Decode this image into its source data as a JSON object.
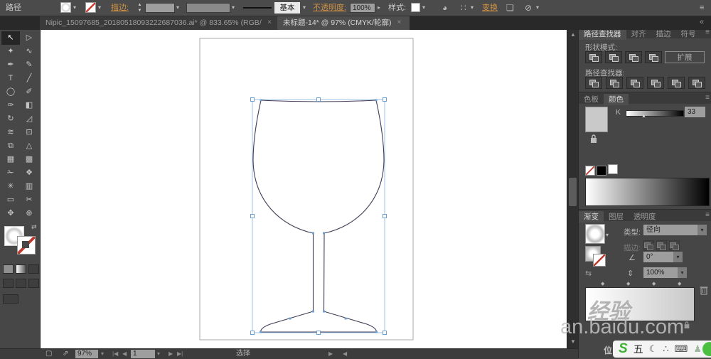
{
  "control_bar": {
    "context_label": "路径",
    "stroke_link": "描边:",
    "brush_value": "基本",
    "opacity_link": "不透明度:",
    "opacity_value": "100%",
    "style_label": "样式:",
    "transform_link": "变换"
  },
  "glyphs": {
    "caret": "▾",
    "caret_right": "▸",
    "up": "▲",
    "down": "▼",
    "left": "◀",
    "right": "▶",
    "first": "|◀",
    "last": "▶|",
    "menu": "≡",
    "collapse": "«",
    "swap": "⇄",
    "recolor": "◕",
    "align_dots": "∷",
    "frame": "❏",
    "no_slash": "⊘",
    "reverse": "⇆",
    "angle": "∠",
    "aspect": "⇕",
    "diamond": "◆",
    "doc_icon": "▢",
    "export_icon": "⇗",
    "k_thumb": "▲"
  },
  "doc_tabs": [
    {
      "title": "Nipic_15097685_20180518093222687036.ai* @ 833.65% (RGB/预览)",
      "close": "×",
      "active": false
    },
    {
      "title": "未标题-14* @ 97% (CMYK/轮廓)",
      "close": "×",
      "active": true
    }
  ],
  "toolbar": {
    "tools": [
      {
        "name": "selection-tool",
        "glyph": "↖",
        "active": true
      },
      {
        "name": "direct-selection-tool",
        "glyph": "▷",
        "active": false
      },
      {
        "name": "magic-wand-tool",
        "glyph": "✦",
        "active": false
      },
      {
        "name": "lasso-tool",
        "glyph": "∿",
        "active": false
      },
      {
        "name": "pen-tool",
        "glyph": "✒",
        "active": false
      },
      {
        "name": "curvature-tool",
        "glyph": "✎",
        "active": false
      },
      {
        "name": "type-tool",
        "glyph": "T",
        "active": false
      },
      {
        "name": "line-segment-tool",
        "glyph": "╱",
        "active": false
      },
      {
        "name": "shape-tool",
        "glyph": "◯",
        "active": false
      },
      {
        "name": "paintbrush-tool",
        "glyph": "✐",
        "active": false
      },
      {
        "name": "pencil-tool",
        "glyph": "✑",
        "active": false
      },
      {
        "name": "eraser-tool",
        "glyph": "◧",
        "active": false
      },
      {
        "name": "rotate-tool",
        "glyph": "↻",
        "active": false
      },
      {
        "name": "scale-tool",
        "glyph": "◿",
        "active": false
      },
      {
        "name": "width-tool",
        "glyph": "≋",
        "active": false
      },
      {
        "name": "free-transform-tool",
        "glyph": "⊡",
        "active": false
      },
      {
        "name": "shape-builder-tool",
        "glyph": "⧉",
        "active": false
      },
      {
        "name": "perspective-grid-tool",
        "glyph": "△",
        "active": false
      },
      {
        "name": "mesh-tool",
        "glyph": "▦",
        "active": false
      },
      {
        "name": "gradient-tool",
        "glyph": "▩",
        "active": false
      },
      {
        "name": "eyedropper-tool",
        "glyph": "✁",
        "active": false
      },
      {
        "name": "blend-tool",
        "glyph": "❖",
        "active": false
      },
      {
        "name": "symbol-sprayer-tool",
        "glyph": "✳",
        "active": false
      },
      {
        "name": "column-graph-tool",
        "glyph": "▥",
        "active": false
      },
      {
        "name": "artboard-tool",
        "glyph": "▭",
        "active": false
      },
      {
        "name": "slice-tool",
        "glyph": "✂",
        "active": false
      },
      {
        "name": "hand-tool",
        "glyph": "✥",
        "active": false
      },
      {
        "name": "zoom-tool",
        "glyph": "⊕",
        "active": false
      }
    ]
  },
  "pathfinder_panel": {
    "tabs": [
      "路径查找器",
      "对齐",
      "描边",
      "符号"
    ],
    "shape_modes_label": "形状模式:",
    "expand_button": "扩展",
    "pathfinder_label": "路径查找器:",
    "shape_mode_names": [
      "unite",
      "minus-front",
      "intersect",
      "exclude"
    ],
    "pathfinder_names": [
      "divide",
      "trim",
      "merge",
      "crop",
      "outline",
      "minus-back"
    ]
  },
  "color_panel": {
    "tabs": [
      "色板",
      "颜色"
    ],
    "active_tab": "颜色",
    "channel": "K",
    "value": "33"
  },
  "gradient_panel": {
    "tabs": [
      "渐变",
      "图层",
      "透明度"
    ],
    "active_tab": "渐变",
    "type_label": "类型:",
    "type_value": "径向",
    "stroke_label": "描边:",
    "angle_value": "0°",
    "aspect_value": "100%"
  },
  "status_bar": {
    "zoom": "97%",
    "artboard": "1",
    "status": "选择"
  },
  "watermark": {
    "logo": "经验",
    "domain": "an.baidu.com",
    "extra": "位"
  },
  "ime": {
    "logo": "S",
    "mode": "五",
    "icons": [
      {
        "name": "moon-icon",
        "glyph": "☾"
      },
      {
        "name": "sparkle-icon",
        "glyph": "∴"
      },
      {
        "name": "keyboard-icon",
        "glyph": "⌨"
      },
      {
        "name": "user-icon",
        "glyph": "♟"
      },
      {
        "name": "wrench-icon",
        "glyph": "⚒"
      }
    ]
  },
  "colors": {
    "accent_orange": "#cf9242",
    "selection_blue": "#9dc3e6",
    "ime_green": "#3eb134",
    "path_stroke": "#3d3d55"
  }
}
